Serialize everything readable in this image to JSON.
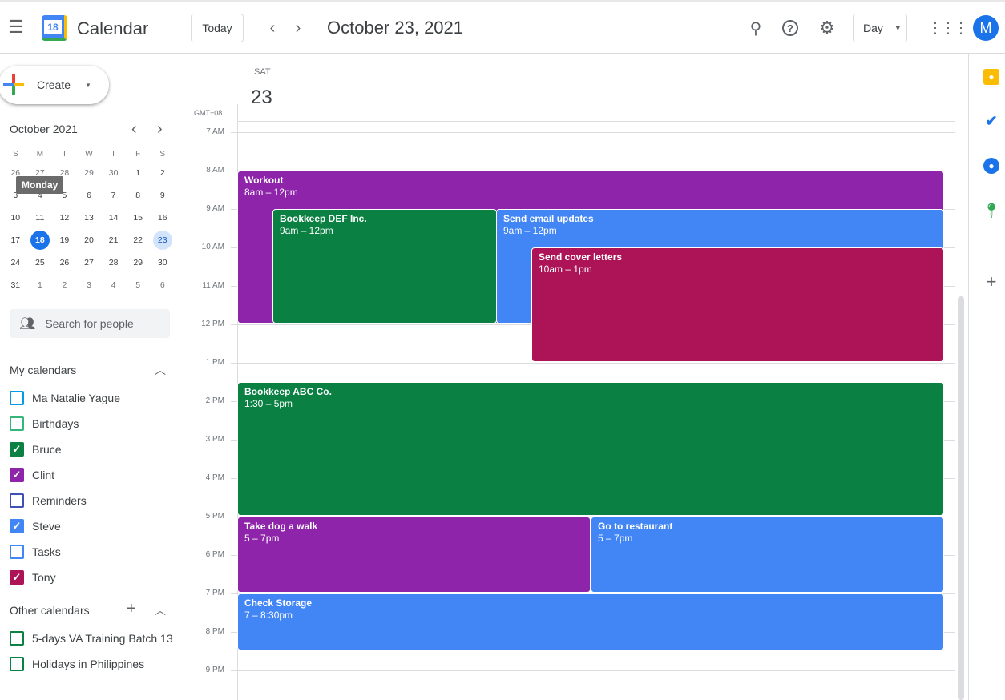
{
  "header": {
    "app_title": "Calendar",
    "logo_day": "18",
    "today": "Today",
    "date": "October 23, 2021",
    "view": "Day",
    "avatar": "M"
  },
  "create": "Create",
  "mini_cal": {
    "title": "October 2021",
    "tooltip": "Monday",
    "weekdays": [
      "S",
      "M",
      "T",
      "W",
      "T",
      "F",
      "S"
    ],
    "weeks": [
      [
        "26",
        "27",
        "28",
        "29",
        "30",
        "1",
        "2"
      ],
      [
        "3",
        "4",
        "5",
        "6",
        "7",
        "8",
        "9"
      ],
      [
        "10",
        "11",
        "12",
        "13",
        "14",
        "15",
        "16"
      ],
      [
        "17",
        "18",
        "19",
        "20",
        "21",
        "22",
        "23"
      ],
      [
        "24",
        "25",
        "26",
        "27",
        "28",
        "29",
        "30"
      ],
      [
        "31",
        "1",
        "2",
        "3",
        "4",
        "5",
        "6"
      ]
    ],
    "today": "18",
    "selected": "23"
  },
  "search_people": "Search for people",
  "my_calendars": {
    "title": "My calendars",
    "items": [
      {
        "label": "Ma Natalie Yague",
        "color": "#039BE5",
        "checked": false
      },
      {
        "label": "Birthdays",
        "color": "#33B679",
        "checked": false
      },
      {
        "label": "Bruce",
        "color": "#0B8043",
        "checked": true
      },
      {
        "label": "Clint",
        "color": "#8E24AA",
        "checked": true
      },
      {
        "label": "Reminders",
        "color": "#3F51B5",
        "checked": false
      },
      {
        "label": "Steve",
        "color": "#4285F4",
        "checked": true
      },
      {
        "label": "Tasks",
        "color": "#4285F4",
        "checked": false
      },
      {
        "label": "Tony",
        "color": "#AD1457",
        "checked": true
      }
    ]
  },
  "other_calendars": {
    "title": "Other calendars",
    "items": [
      {
        "label": "5-days VA Training Batch 13",
        "color": "#0B8043",
        "checked": false
      },
      {
        "label": "Holidays in Philippines",
        "color": "#0B8043",
        "checked": false
      }
    ]
  },
  "day": {
    "weekday": "SAT",
    "number": "23",
    "tz": "GMT+08"
  },
  "hours": [
    "7 AM",
    "8 AM",
    "9 AM",
    "10 AM",
    "11 AM",
    "12 PM",
    "1 PM",
    "2 PM",
    "3 PM",
    "4 PM",
    "5 PM",
    "6 PM",
    "7 PM",
    "8 PM",
    "9 PM"
  ],
  "events": [
    {
      "title": "Workout",
      "time": "8am – 12pm",
      "start": 8,
      "end": 12,
      "col": 0,
      "span": 1,
      "color": "#8E24AA"
    },
    {
      "title": "Bookkeep DEF Inc.",
      "time": "9am – 12pm",
      "start": 9,
      "end": 12,
      "color": "#0B8043"
    },
    {
      "title": "Send email updates",
      "time": "9am – 12pm",
      "start": 9,
      "end": 12,
      "color": "#4285F4"
    },
    {
      "title": "Send cover letters",
      "time": "10am – 1pm",
      "start": 10,
      "end": 13,
      "color": "#AD1457"
    },
    {
      "title": "Bookkeep ABC Co.",
      "time": "1:30 – 5pm",
      "start": 13.5,
      "end": 17,
      "color": "#0B8043"
    },
    {
      "title": "Take dog a walk",
      "time": "5 – 7pm",
      "start": 17,
      "end": 19,
      "color": "#8E24AA"
    },
    {
      "title": "Go to restaurant",
      "time": "5 – 7pm",
      "start": 17,
      "end": 19,
      "color": "#4285F4"
    },
    {
      "title": "Check Storage",
      "time": "7 – 8:30pm",
      "start": 19,
      "end": 20.5,
      "color": "#4285F4"
    }
  ]
}
